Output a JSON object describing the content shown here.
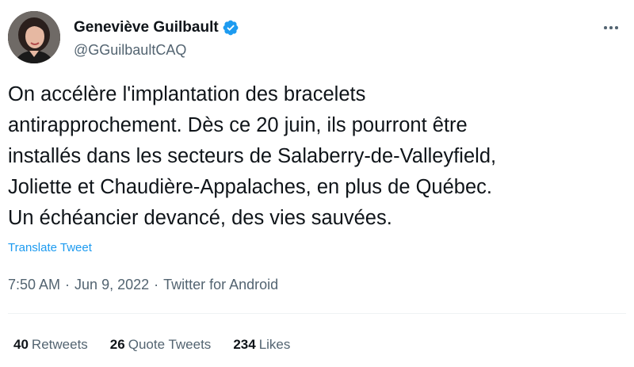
{
  "author": {
    "display_name": "Geneviève Guilbault",
    "handle": "@GGuilbaultCAQ",
    "verified": true,
    "verified_color": "#1d9bf0"
  },
  "tweet": {
    "lines": [
      "On accélère l'implantation des bracelets",
      "antirapprochement. Dès ce 20 juin, ils pourront être",
      "installés dans les secteurs de Salaberry-de-Valleyfield,",
      "Joliette et Chaudière-Appalaches, en plus de Québec.",
      "Un échéancier devancé, des vies sauvées."
    ],
    "translate_label": "Translate Tweet",
    "time": "7:50 AM",
    "date": "Jun 9, 2022",
    "source": "Twitter for Android",
    "separator": "·"
  },
  "stats": {
    "retweets_count": "40",
    "retweets_label": "Retweets",
    "quotes_count": "26",
    "quotes_label": "Quote Tweets",
    "likes_count": "234",
    "likes_label": "Likes"
  },
  "icons": {
    "verified": "verified-badge-icon",
    "more": "more-horizontal-icon"
  },
  "colors": {
    "link": "#1d9bf0",
    "secondary_text": "#536471",
    "primary_text": "#0f1419"
  }
}
